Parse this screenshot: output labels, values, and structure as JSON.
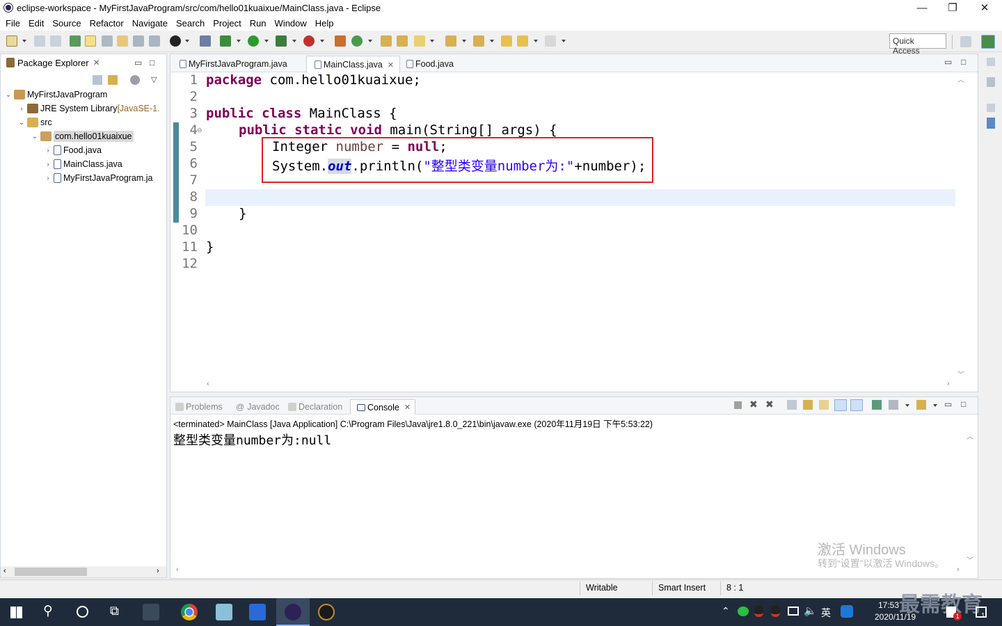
{
  "window": {
    "title": "eclipse-workspace - MyFirstJavaProgram/src/com/hello01kuaixue/MainClass.java - Eclipse",
    "minimize": "—",
    "maximize": "❐",
    "close": "✕"
  },
  "menu": [
    "File",
    "Edit",
    "Source",
    "Refactor",
    "Navigate",
    "Search",
    "Project",
    "Run",
    "Window",
    "Help"
  ],
  "toolbar": {
    "quick_access": "Quick Access"
  },
  "package_explorer": {
    "title": "Package Explorer",
    "tree": [
      {
        "label": "MyFirstJavaProgram",
        "depth": 0,
        "twisty": "⌄",
        "icon": "project-icon"
      },
      {
        "label": "JRE System Library",
        "suffix": "[JavaSE-1.",
        "depth": 1,
        "twisty": "›",
        "icon": "library-icon"
      },
      {
        "label": "src",
        "depth": 1,
        "twisty": "⌄",
        "icon": "source-folder-icon"
      },
      {
        "label": "com.hello01kuaixue",
        "depth": 2,
        "twisty": "⌄",
        "icon": "package-icon",
        "selected": true
      },
      {
        "label": "Food.java",
        "depth": 3,
        "twisty": "›",
        "icon": "java-file-icon"
      },
      {
        "label": "MainClass.java",
        "depth": 3,
        "twisty": "›",
        "icon": "java-file-icon"
      },
      {
        "label": "MyFirstJavaProgram.ja",
        "depth": 3,
        "twisty": "›",
        "icon": "java-file-icon"
      }
    ]
  },
  "editor": {
    "tabs": [
      {
        "label": "MyFirstJavaProgram.java",
        "active": false
      },
      {
        "label": "MainClass.java",
        "active": true
      },
      {
        "label": "Food.java",
        "active": false
      }
    ],
    "line_numbers": [
      "1",
      "2",
      "3",
      "4",
      "5",
      "6",
      "7",
      "8",
      "9",
      "10",
      "11",
      "12"
    ],
    "code": {
      "l1_kw": "package",
      "l1_rest": " com.hello01kuaixue;",
      "l3_kw": "public class",
      "l3_rest": " MainClass {",
      "l4_kw": "public static void",
      "l4_rest": " main(String[] args) {",
      "l5_a": "Integer ",
      "l5_var": "number",
      "l5_b": " = ",
      "l5_kw": "null",
      "l5_c": ";",
      "l6_a": "System.",
      "l6_fld": "out",
      "l6_b": ".println(",
      "l6_str": "\"整型类变量number为:\"",
      "l6_c": "+number);",
      "l9": "}",
      "l11": "}"
    },
    "current_line": 8
  },
  "console": {
    "tabs": [
      "Problems",
      "Javadoc",
      "Declaration",
      "Console"
    ],
    "header": "<terminated> MainClass [Java Application] C:\\Program Files\\Java\\jre1.8.0_221\\bin\\javaw.exe (2020年11月19日 下午5:53:22)",
    "output": "整型类变量number为:null"
  },
  "status": {
    "writable": "Writable",
    "insert": "Smart Insert",
    "position": "8 : 1"
  },
  "watermark": {
    "line1": "激活 Windows",
    "line2": "转到“设置”以激活 Windows。",
    "brand": "最需教育"
  },
  "taskbar": {
    "time": "17:53",
    "date": "2020/11/19",
    "ime": "英",
    "notif": "1"
  },
  "colors": {
    "keyword": "#7f0055",
    "string": "#2a00ff",
    "field": "#0000c0",
    "highlight_box": "#e02020",
    "current_line": "#e8f2fe"
  }
}
